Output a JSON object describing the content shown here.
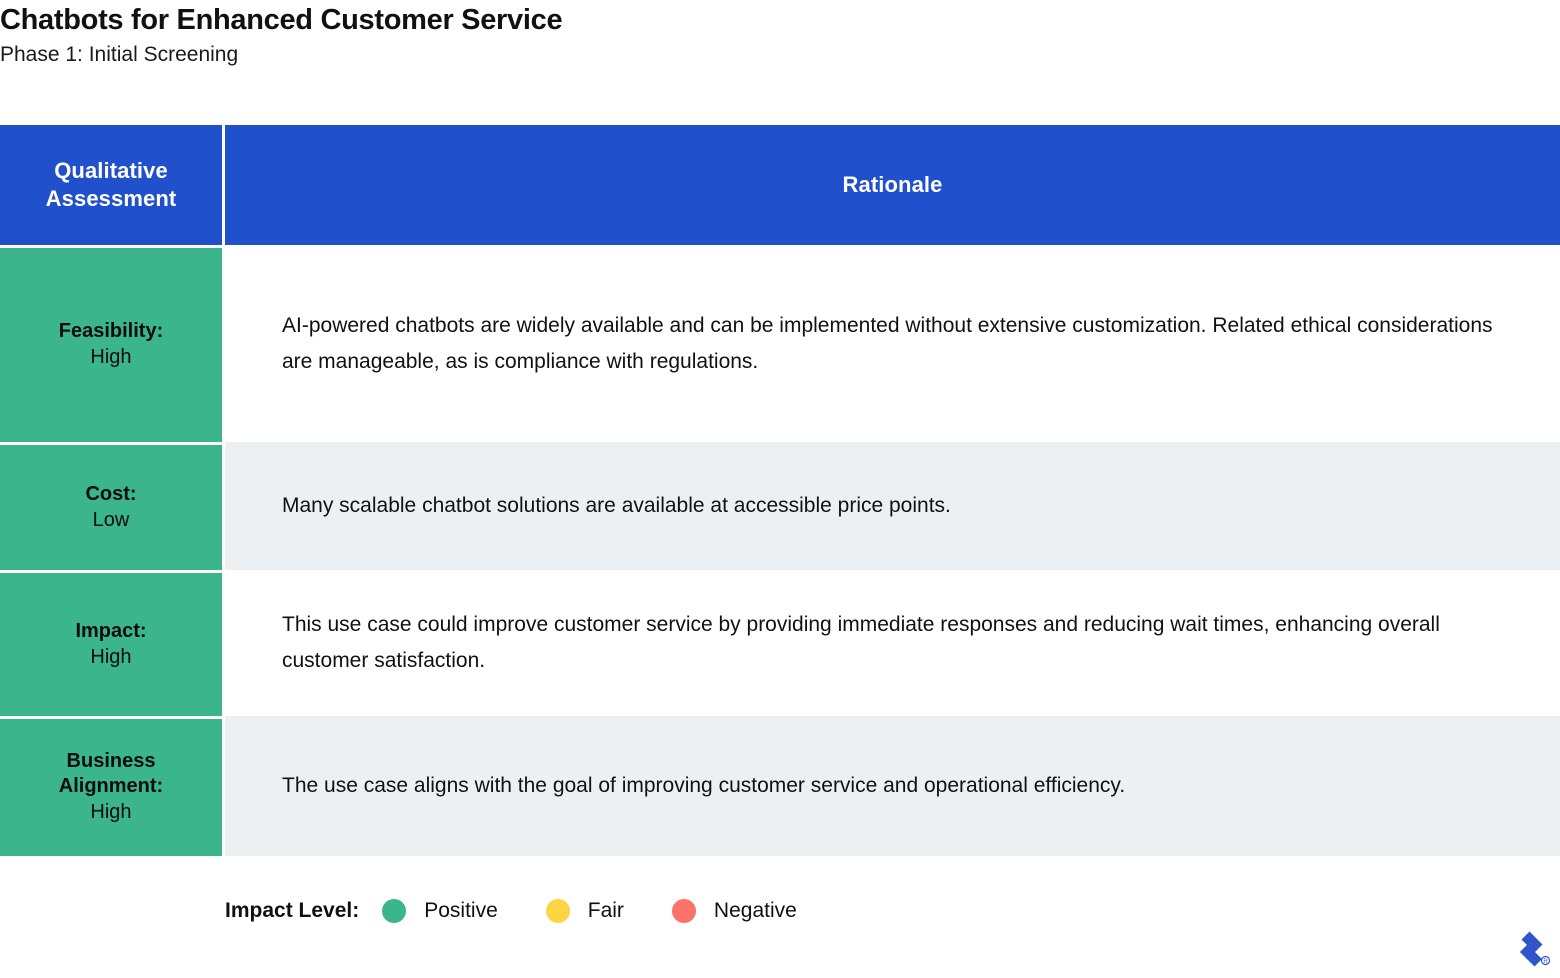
{
  "title": "Chatbots for Enhanced Customer Service",
  "subtitle": "Phase 1: Initial Screening",
  "table": {
    "headers": {
      "col1": "Qualitative\nAssessment",
      "col1_line1": "Qualitative",
      "col1_line2": "Assessment",
      "col2": "Rationale"
    },
    "rows": [
      {
        "assessment_name": "Feasibility:",
        "assessment_value": "High",
        "level": "Positive",
        "level_color": "#3bb58c",
        "rationale": "AI-powered chatbots are widely available and can be implemented without extensive customization. Related ethical considerations are manageable, as is compliance with regulations."
      },
      {
        "assessment_name": "Cost:",
        "assessment_value": "Low",
        "level": "Positive",
        "level_color": "#3bb58c",
        "rationale": "Many scalable chatbot solutions are available at accessible price points."
      },
      {
        "assessment_name": "Impact:",
        "assessment_value": "High",
        "level": "Positive",
        "level_color": "#3bb58c",
        "rationale": "This use case could improve customer service by providing immediate responses and reducing wait times, enhancing overall customer satisfaction."
      },
      {
        "assessment_name_line1": "Business",
        "assessment_name_line2": "Alignment:",
        "assessment_name": "Business Alignment:",
        "assessment_value": "High",
        "level": "Positive",
        "level_color": "#3bb58c",
        "rationale": "The use case aligns with the goal of improving customer service and operational efficiency."
      }
    ]
  },
  "legend": {
    "title": "Impact Level:",
    "items": [
      {
        "label": "Positive",
        "color": "#3bb58c"
      },
      {
        "label": "Fair",
        "color": "#fdd542"
      },
      {
        "label": "Negative",
        "color": "#fa7268"
      }
    ]
  },
  "colors": {
    "header_blue": "#2050cc",
    "cell_green": "#3bb58c",
    "alt_row": "#ecf0f3",
    "logo_blue": "#2f55c8"
  },
  "logo": {
    "name": "toptal-logo",
    "trademark": "®"
  }
}
